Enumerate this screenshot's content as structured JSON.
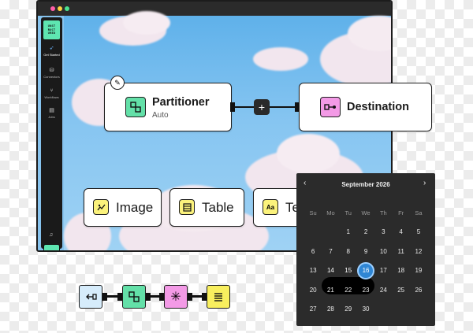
{
  "sidebar": {
    "logo_lines": [
      "UNST",
      "RUCT",
      "URED"
    ],
    "items": [
      {
        "label": "Get Started",
        "icon": "rocket-icon"
      },
      {
        "label": "Connectors",
        "icon": "database-icon"
      },
      {
        "label": "Workflows",
        "icon": "workflow-icon"
      },
      {
        "label": "Jobs",
        "icon": "briefcase-icon"
      }
    ]
  },
  "canvas": {
    "partitioner": {
      "title": "Partitioner",
      "subtitle": "Auto"
    },
    "destination": {
      "title": "Destination"
    },
    "add_symbol": "+",
    "nodes": [
      {
        "label": "Image",
        "icon": "image-icon",
        "color": "#fbf27c"
      },
      {
        "label": "Table",
        "icon": "table-icon",
        "color": "#fbf27c"
      },
      {
        "label": "Text",
        "icon": "text-icon",
        "color": "#fbf27c",
        "visible_label": "Te"
      }
    ]
  },
  "calendar": {
    "month": "September 2026",
    "weekdays": [
      "Su",
      "Mo",
      "Tu",
      "We",
      "Th",
      "Fr",
      "Sa"
    ],
    "weeks": [
      [
        "",
        "",
        "1",
        "2",
        "3",
        "4",
        "5"
      ],
      [
        "6",
        "7",
        "8",
        "9",
        "10",
        "11",
        "12"
      ],
      [
        "13",
        "14",
        "15",
        "16",
        "17",
        "18",
        "19"
      ],
      [
        "20",
        "21",
        "22",
        "23",
        "24",
        "25",
        "26"
      ],
      [
        "27",
        "28",
        "29",
        "30",
        "",
        "",
        ""
      ]
    ],
    "range_start": "14",
    "range_end": "16",
    "selected": "16"
  },
  "pipeline": {
    "steps": [
      {
        "icon": "source-icon",
        "color": "#d6ecfb"
      },
      {
        "icon": "partition-icon",
        "color": "#63e0a8"
      },
      {
        "icon": "sparkle-icon",
        "color": "#f39ae6"
      },
      {
        "icon": "document-icon",
        "color": "#f8ef5e"
      }
    ]
  },
  "colors": {
    "accent_green": "#5ee6b1",
    "partitioner_tile": "#63e0a8",
    "destination_tile": "#f39ae6",
    "selected_day": "#2f86d4"
  }
}
